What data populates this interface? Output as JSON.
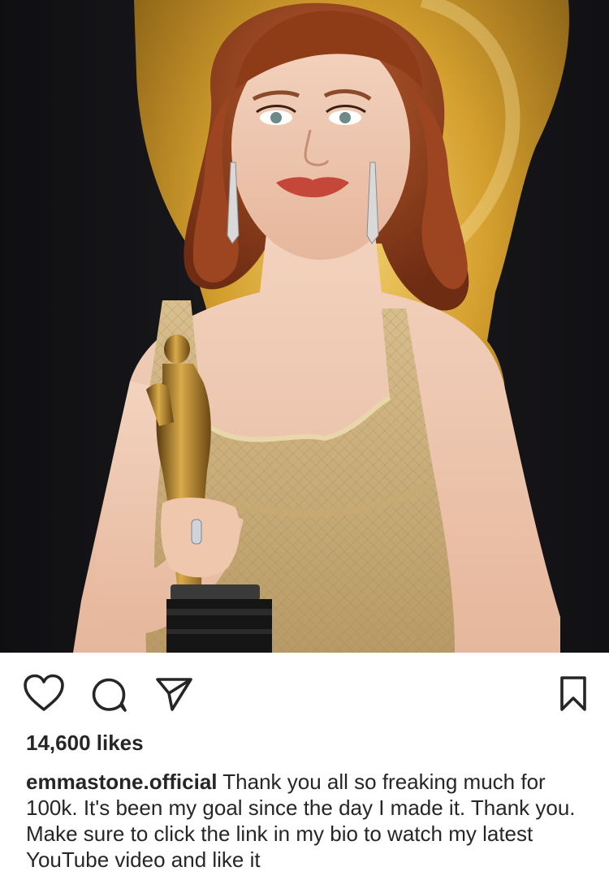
{
  "post": {
    "photo": {
      "subject": "photo-woman-with-oscar-statuette"
    },
    "actions": {
      "like_icon": "heart-outline-icon",
      "comment_icon": "speech-bubble-icon",
      "share_icon": "paper-plane-icon",
      "save_icon": "bookmark-icon"
    },
    "likes_text": "14,600 likes",
    "caption": {
      "username": "emmastone.official",
      "text": "Thank you all so freaking much for 100k. It's been my goal since the day I made it. Thank you. Make sure to click the link in my bio to watch my latest YouTube video and like it"
    }
  },
  "colors": {
    "text": "#262626",
    "background": "#ffffff"
  }
}
